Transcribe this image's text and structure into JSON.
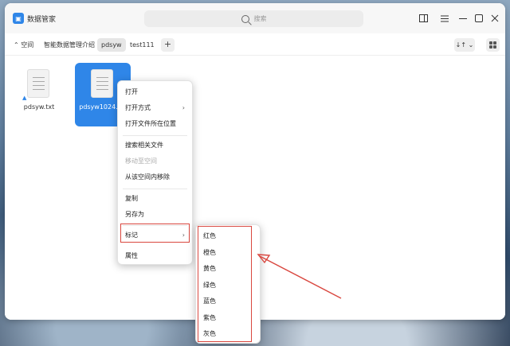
{
  "app": {
    "title": "数据管家"
  },
  "search": {
    "placeholder": "搜索"
  },
  "toolbar": {
    "back_label": "空间",
    "tabs": [
      "智能数据管理介绍",
      "pdsyw",
      "test111"
    ],
    "add_label": "+",
    "sort_label": "↓↑ ⌄"
  },
  "files": [
    {
      "name": "pdsyw.txt"
    },
    {
      "name": "pdsyw1024.txt"
    }
  ],
  "context_menu": {
    "items": [
      "打开",
      "打开方式",
      "打开文件所在位置",
      "搜索相关文件",
      "移动至空间",
      "从该空间内移除",
      "复制",
      "另存为",
      "标记",
      "属性"
    ]
  },
  "tag_menu": {
    "items": [
      "红色",
      "橙色",
      "黄色",
      "绿色",
      "蓝色",
      "紫色",
      "灰色"
    ]
  },
  "colors": {
    "accent": "#2f86e8",
    "annotation": "#d9473f"
  }
}
